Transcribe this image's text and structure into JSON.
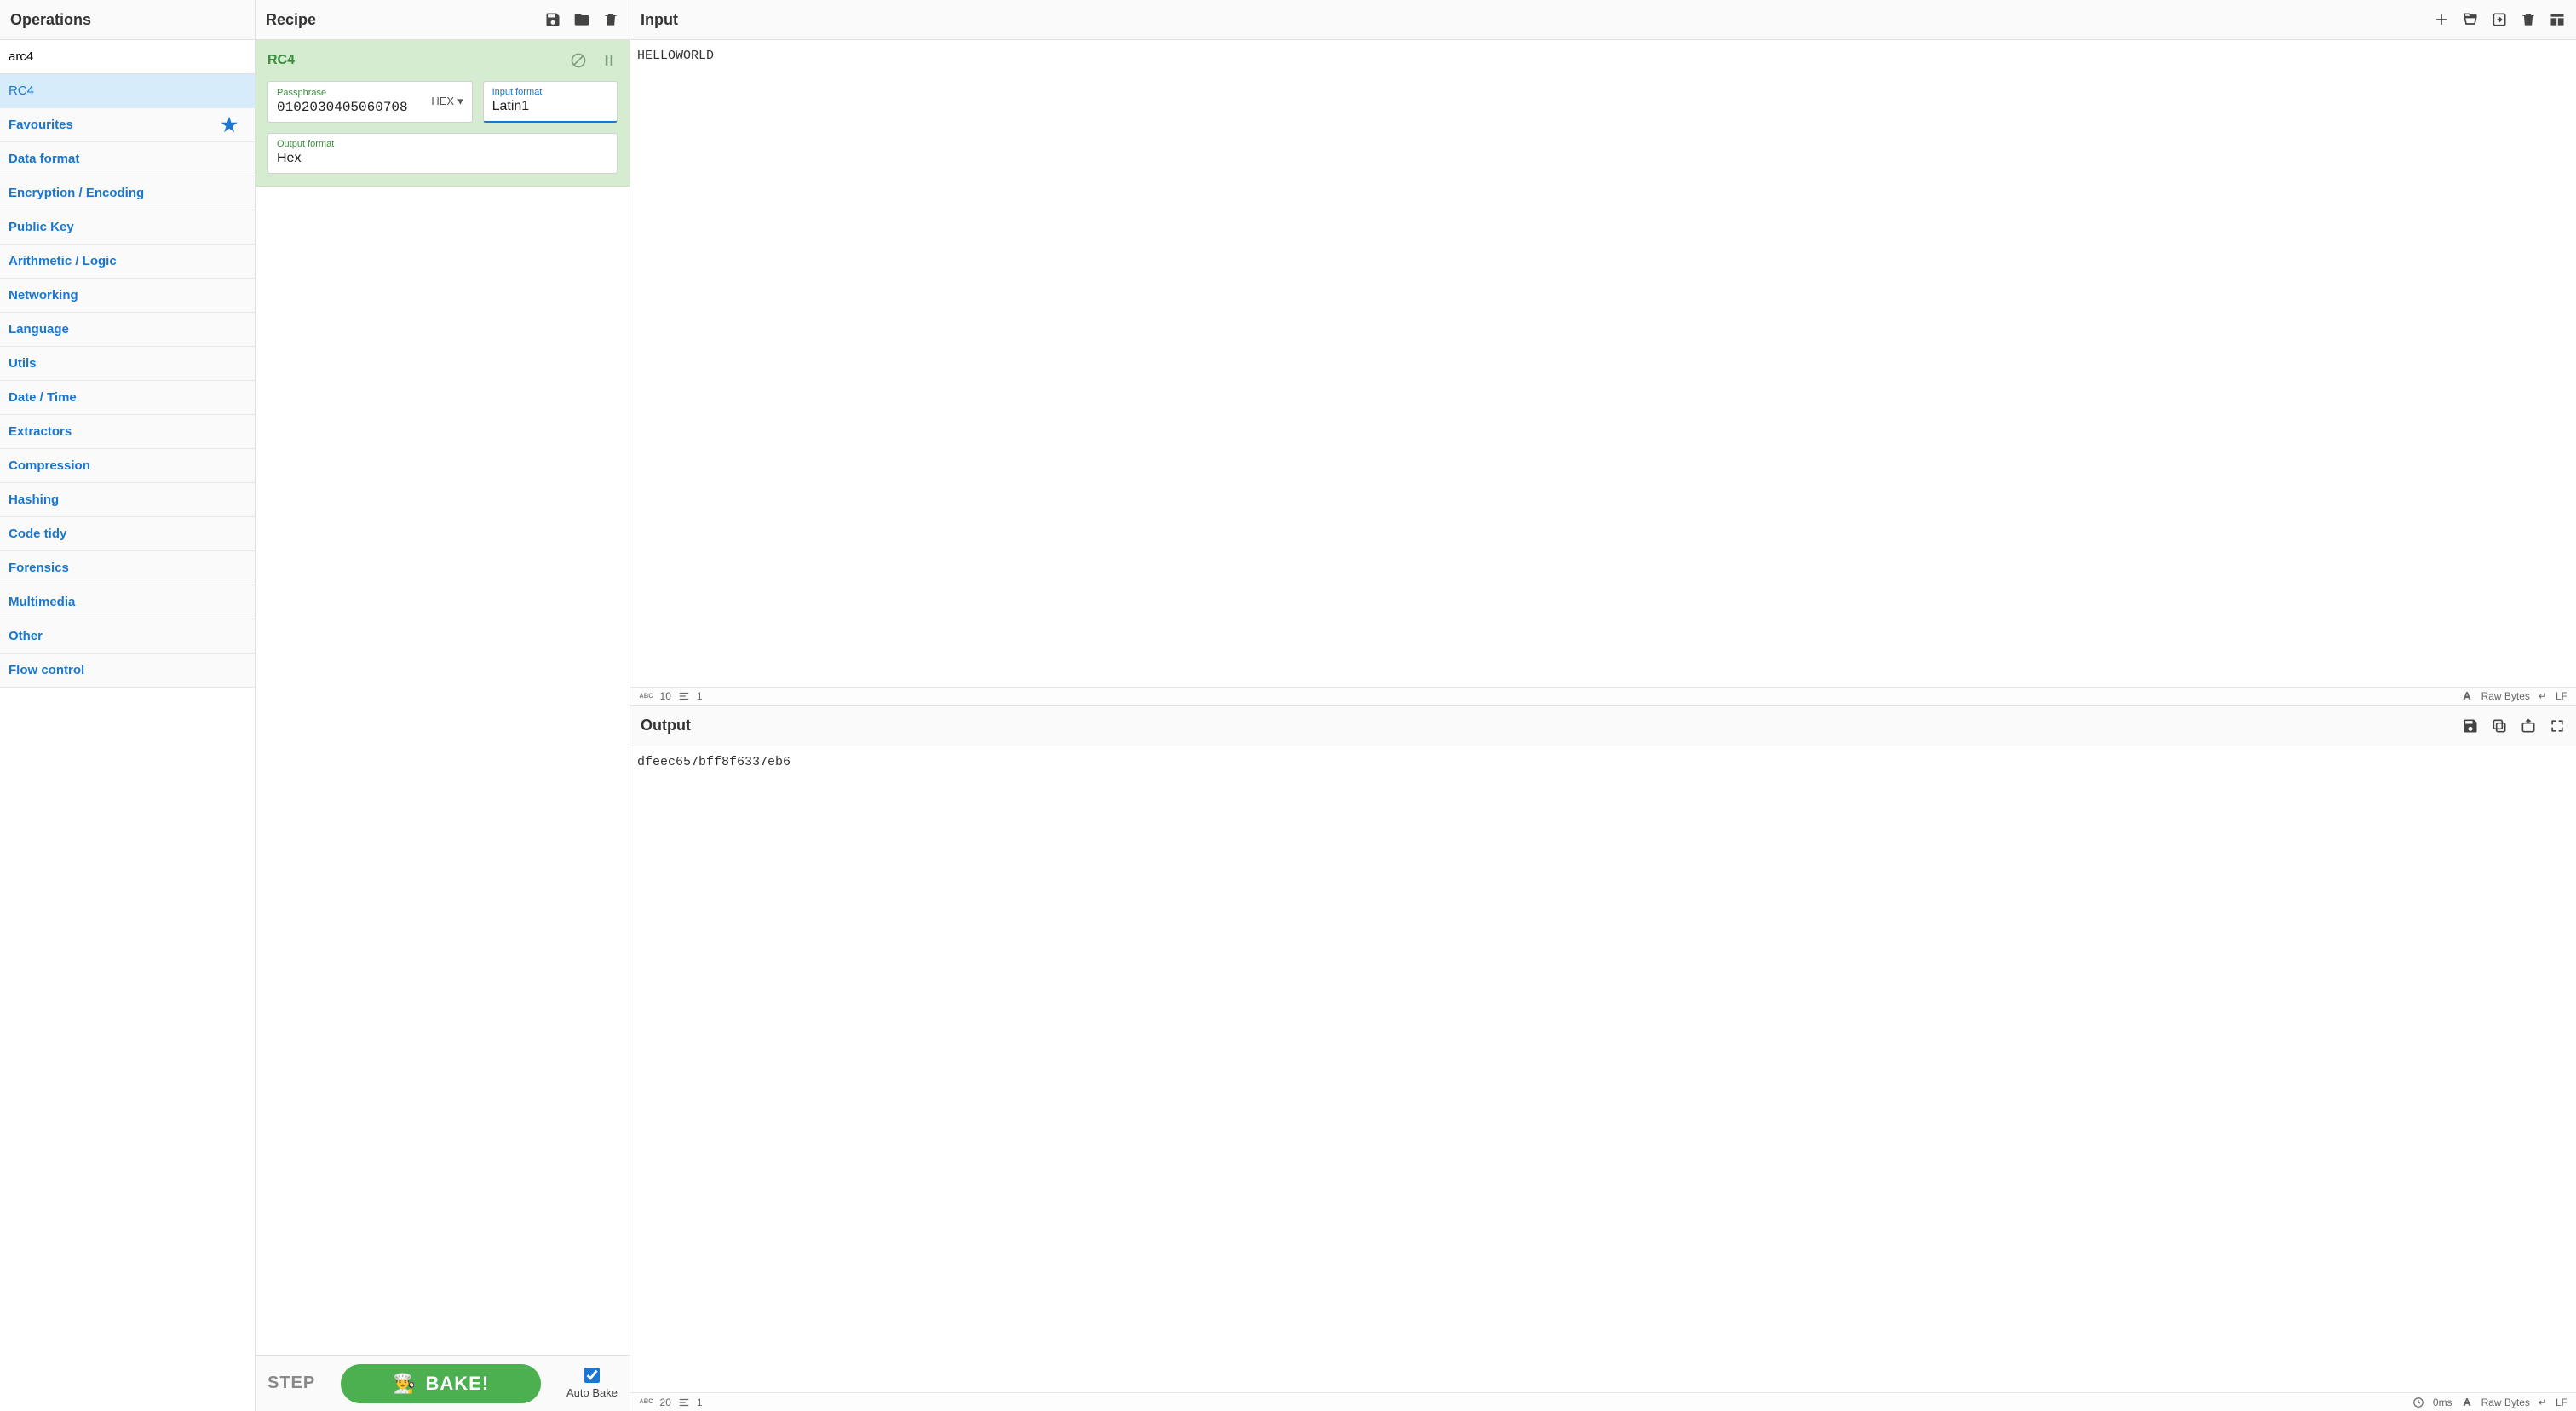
{
  "operations": {
    "title": "Operations",
    "search_value": "arc4",
    "search_results": [
      "RC4"
    ],
    "categories": [
      {
        "label": "Favourites",
        "starred": true
      },
      {
        "label": "Data format"
      },
      {
        "label": "Encryption / Encoding"
      },
      {
        "label": "Public Key"
      },
      {
        "label": "Arithmetic / Logic"
      },
      {
        "label": "Networking"
      },
      {
        "label": "Language"
      },
      {
        "label": "Utils"
      },
      {
        "label": "Date / Time"
      },
      {
        "label": "Extractors"
      },
      {
        "label": "Compression"
      },
      {
        "label": "Hashing"
      },
      {
        "label": "Code tidy"
      },
      {
        "label": "Forensics"
      },
      {
        "label": "Multimedia"
      },
      {
        "label": "Other"
      },
      {
        "label": "Flow control"
      }
    ]
  },
  "recipe": {
    "title": "Recipe",
    "operations": [
      {
        "name": "RC4",
        "passphrase_label": "Passphrase",
        "passphrase_value": "0102030405060708",
        "passphrase_type": "HEX",
        "input_format_label": "Input format",
        "input_format_value": "Latin1",
        "output_format_label": "Output format",
        "output_format_value": "Hex"
      }
    ],
    "step_label": "STEP",
    "bake_label": "BAKE!",
    "autobake_label": "Auto Bake",
    "autobake_checked": true
  },
  "input": {
    "title": "Input",
    "text": "HELLOWORLD",
    "status": {
      "chars": "10",
      "lines": "1",
      "encoding": "Raw Bytes",
      "eol": "LF"
    }
  },
  "output": {
    "title": "Output",
    "text": "dfeec657bff8f6337eb6",
    "status": {
      "chars": "20",
      "lines": "1",
      "time": "0ms",
      "encoding": "Raw Bytes",
      "eol": "LF"
    }
  }
}
